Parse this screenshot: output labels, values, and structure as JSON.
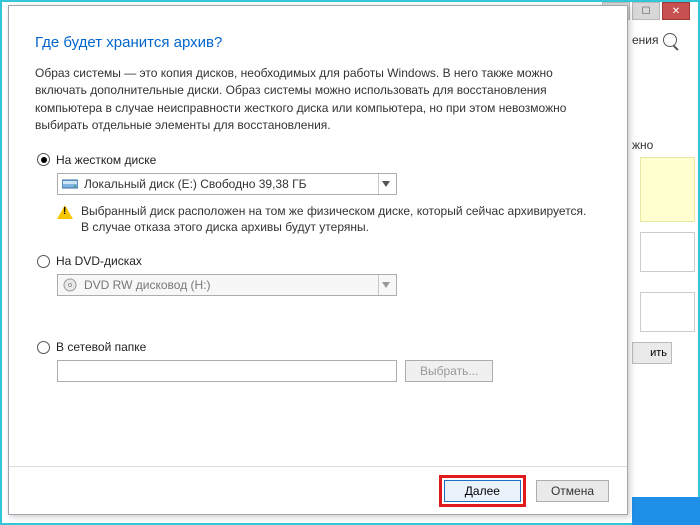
{
  "heading": "Где будет хранится архив?",
  "description": "Образ системы — это копия дисков, необходимых для работы Windows. В него также можно включать дополнительные диски. Образ системы можно использовать для восстановления компьютера в случае неисправности жесткого диска или компьютера, но при этом невозможно выбирать отдельные элементы для восстановления.",
  "options": {
    "hdd": {
      "label": "На жестком диске",
      "selected": "Локальный диск (E:)   Свободно 39,38 ГБ",
      "warning": "Выбранный диск расположен на том же физическом диске, который сейчас архивируется. В случае отказа этого диска архивы будут утеряны."
    },
    "dvd": {
      "label": "На DVD-дисках",
      "selected": "DVD RW дисковод (H:)"
    },
    "network": {
      "label": "В сетевой папке",
      "browse": "Выбрать..."
    }
  },
  "buttons": {
    "next": "Далее",
    "cancel": "Отмена"
  },
  "background": {
    "tab_fragment": "ения",
    "word_fragment": "жно",
    "btn_fragment": "ить"
  }
}
